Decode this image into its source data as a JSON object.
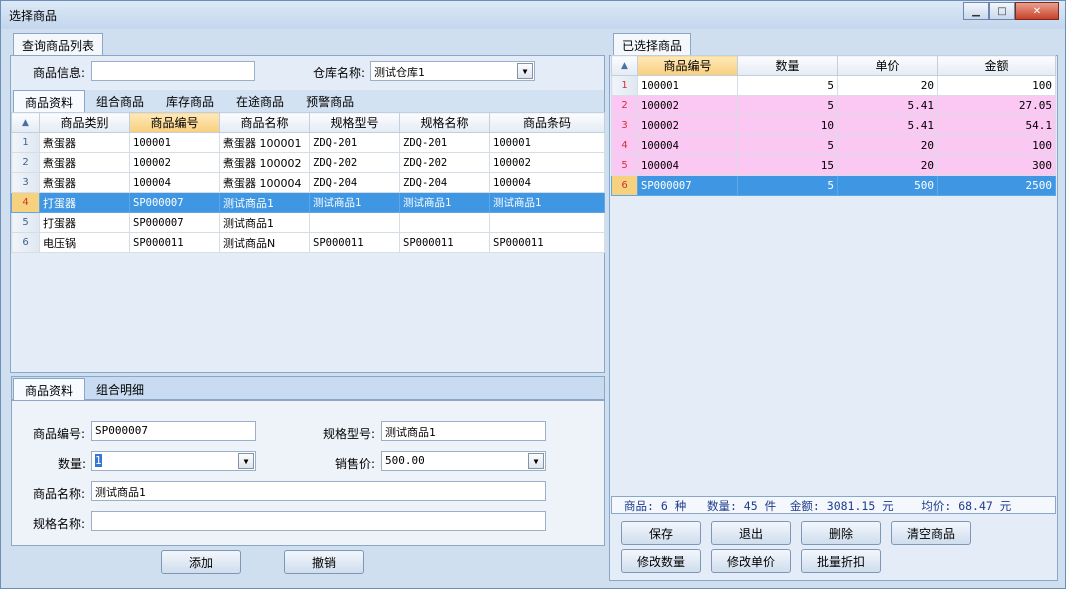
{
  "window": {
    "title": "选择商品",
    "min": "▁",
    "max": "□",
    "close": "✕"
  },
  "left": {
    "query_tab": "查询商品列表",
    "product_info_label": "商品信息:",
    "product_info_value": "",
    "warehouse_label": "仓库名称:",
    "warehouse_value": "测试仓库1",
    "tabs": [
      "商品资料",
      "组合商品",
      "库存商品",
      "在途商品",
      "预警商品"
    ],
    "grid": {
      "headers": [
        "商品类别",
        "商品编号",
        "商品名称",
        "规格型号",
        "规格名称",
        "商品条码"
      ],
      "rows": [
        {
          "n": "1",
          "c": [
            "煮蛋器",
            "100001",
            "煮蛋器 100001",
            "ZDQ-201",
            "ZDQ-201",
            "100001"
          ]
        },
        {
          "n": "2",
          "c": [
            "煮蛋器",
            "100002",
            "煮蛋器 100002",
            "ZDQ-202",
            "ZDQ-202",
            "100002"
          ]
        },
        {
          "n": "3",
          "c": [
            "煮蛋器",
            "100004",
            "煮蛋器 100004",
            "ZDQ-204",
            "ZDQ-204",
            "100004"
          ]
        },
        {
          "n": "4",
          "c": [
            "打蛋器",
            "SP000007",
            "测试商品1",
            "测试商品1",
            "测试商品1",
            "测试商品1"
          ]
        },
        {
          "n": "5",
          "c": [
            "打蛋器",
            "SP000007",
            "测试商品1",
            "",
            "",
            ""
          ]
        },
        {
          "n": "6",
          "c": [
            "电压锅",
            "SP000011",
            "测试商品N",
            "SP000011",
            "SP000011",
            "SP000011"
          ]
        }
      ]
    },
    "detail_tabs": [
      "商品资料",
      "组合明细"
    ],
    "detail": {
      "code_label": "商品编号:",
      "code_value": "SP000007",
      "spec_model_label": "规格型号:",
      "spec_model_value": "测试商品1",
      "qty_label": "数量:",
      "qty_value": "1",
      "price_label": "销售价:",
      "price_value": "500.00",
      "name_label": "商品名称:",
      "name_value": "测试商品1",
      "spec_name_label": "规格名称:",
      "spec_name_value": ""
    },
    "add_button": "添加",
    "cancel_button": "撤销"
  },
  "right": {
    "tab": "已选择商品",
    "grid": {
      "headers": [
        "商品编号",
        "数量",
        "单价",
        "金额"
      ],
      "rows": [
        {
          "n": "1",
          "c": [
            "100001",
            "5",
            "20",
            "100"
          ]
        },
        {
          "n": "2",
          "c": [
            "100002",
            "5",
            "5.41",
            "27.05"
          ]
        },
        {
          "n": "3",
          "c": [
            "100002",
            "10",
            "5.41",
            "54.1"
          ]
        },
        {
          "n": "4",
          "c": [
            "100004",
            "5",
            "20",
            "100"
          ]
        },
        {
          "n": "5",
          "c": [
            "100004",
            "15",
            "20",
            "300"
          ]
        },
        {
          "n": "6",
          "c": [
            "SP000007",
            "5",
            "500",
            "2500"
          ]
        }
      ]
    },
    "summary": "商品: 6 种   数量: 45 件  金额: 3081.15 元    均价: 68.47 元",
    "buttons": [
      "保存",
      "退出",
      "删除",
      "清空商品",
      "修改数量",
      "修改单价",
      "批量折扣"
    ]
  },
  "colors": {
    "selected_row": "#3f96e2",
    "pink_row": "#fbc8f4",
    "sort_header": "#f8cf7e"
  }
}
